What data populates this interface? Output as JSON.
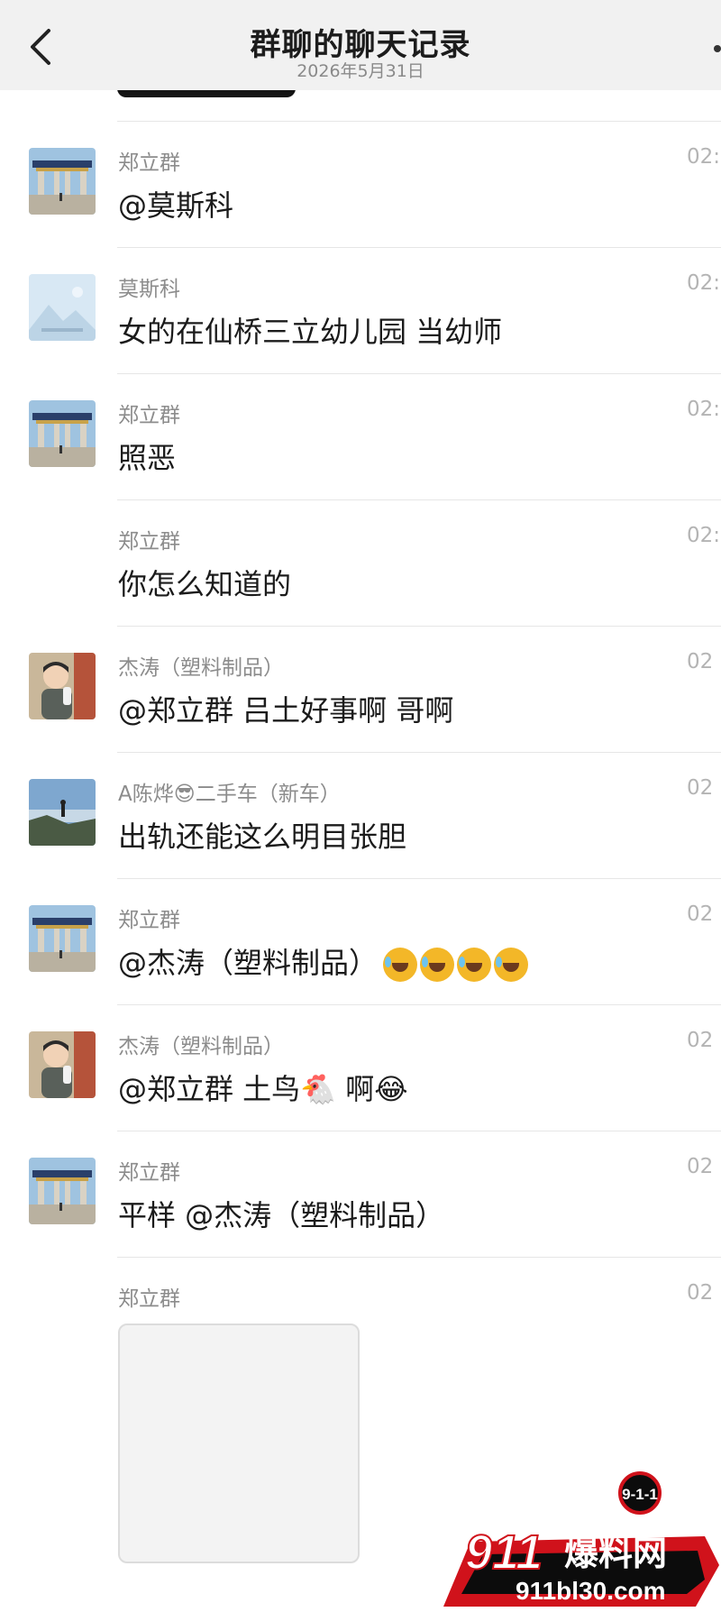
{
  "header": {
    "title": "群聊的聊天记录",
    "date": "2026年5月31日"
  },
  "messages": [
    {
      "sender": "郑立群",
      "time": "02:",
      "text": "@莫斯科",
      "avatar": "gate-avatar"
    },
    {
      "sender": "莫斯科",
      "time": "02:",
      "text": "女的在仙桥三立幼儿园 当幼师",
      "avatar": "landscape-placeholder-avatar"
    },
    {
      "sender": "郑立群",
      "time": "02:",
      "text": "照恶",
      "avatar": "gate-avatar"
    },
    {
      "sender": "郑立群",
      "time": "02:",
      "text": "你怎么知道的",
      "avatar": ""
    },
    {
      "sender": "杰涛（塑料制品）",
      "time": "02",
      "text": "@郑立群 吕土好事啊 哥啊",
      "avatar": "child-avatar"
    },
    {
      "sender": "A陈烨😎二手车（新车）",
      "time": "02",
      "text": "出轨还能这么明目张胆",
      "avatar": "mountain-avatar"
    },
    {
      "sender": "郑立群",
      "time": "02",
      "text": "@杰涛（塑料制品）",
      "emoji": "😂😂😂😂",
      "avatar": "gate-avatar"
    },
    {
      "sender": "杰涛（塑料制品）",
      "time": "02",
      "text": "@郑立群 土鸟🐔 啊😂",
      "avatar": "child-avatar"
    },
    {
      "sender": "郑立群",
      "time": "02",
      "text": "平样 @杰涛（塑料制品）",
      "avatar": "gate-avatar"
    },
    {
      "sender": "郑立群",
      "time": "02",
      "text": "",
      "avatar": ""
    }
  ],
  "watermark": {
    "badge": "9-1-1",
    "brand": "911爆料网",
    "url": "911bl30.com"
  },
  "colors": {
    "header_bg": "#f1f1f1",
    "sender": "#8c8c8c",
    "time": "#b4b4b4",
    "watermark_red": "#d0121b"
  }
}
